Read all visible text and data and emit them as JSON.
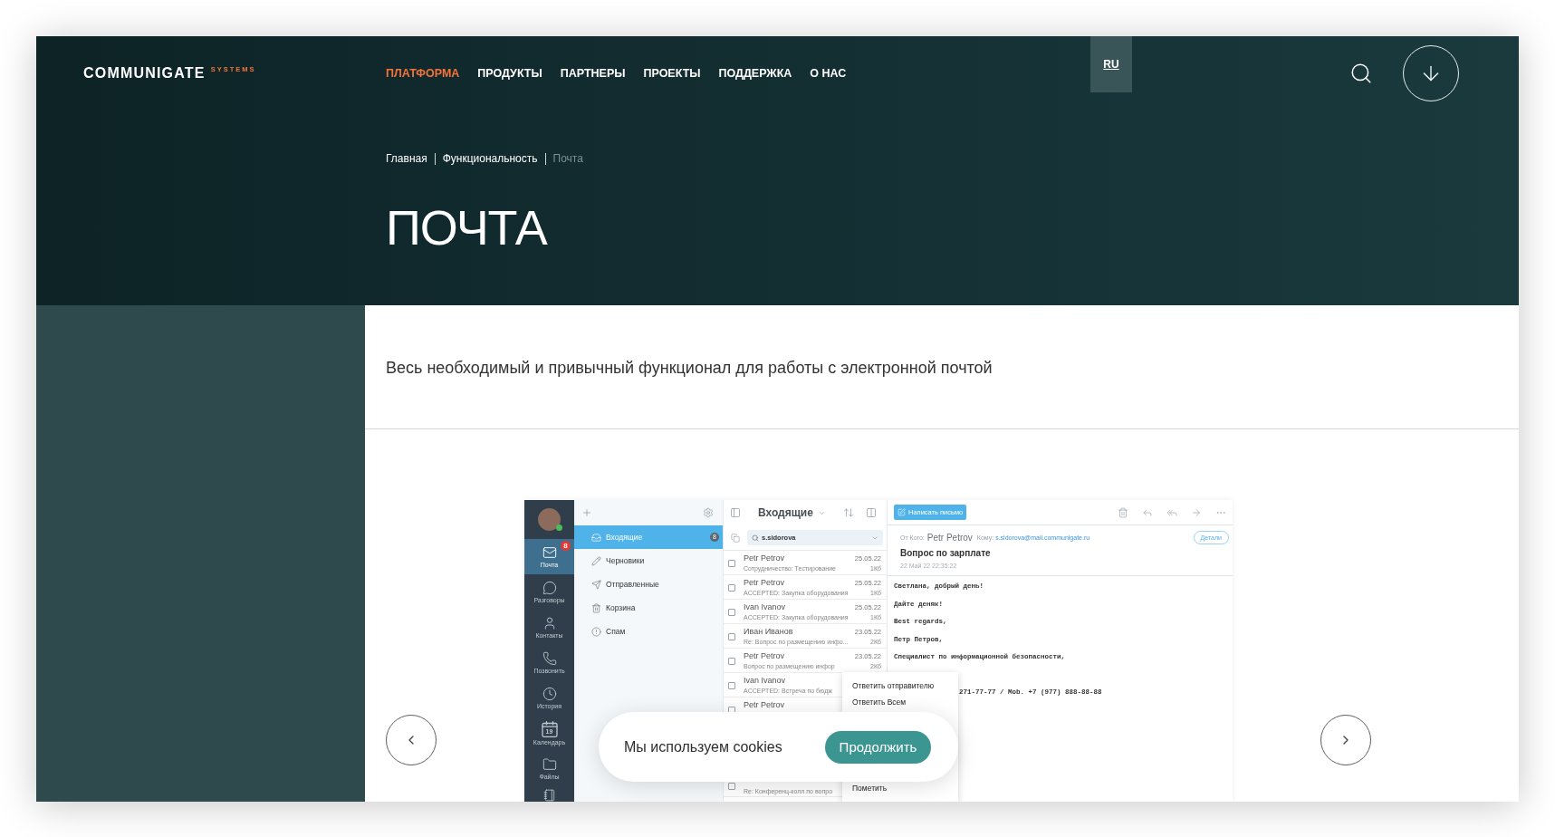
{
  "header": {
    "logo": {
      "wordmark": "COMMUNIGATE",
      "tagline": "SYSTEMS"
    },
    "nav": [
      {
        "label": "ПЛАТФОРМА",
        "selected": true
      },
      {
        "label": "ПРОДУКТЫ",
        "selected": false
      },
      {
        "label": "ПАРТНЕРЫ",
        "selected": false
      },
      {
        "label": "ПРОЕКТЫ",
        "selected": false
      },
      {
        "label": "ПОДДЕРЖКА",
        "selected": false
      },
      {
        "label": "О НАС",
        "selected": false
      }
    ],
    "language": {
      "label": "RU",
      "selected": true
    }
  },
  "breadcrumbs": [
    {
      "label": "Главная",
      "current": false
    },
    {
      "label": "Функциональность",
      "current": false
    },
    {
      "label": "Почта",
      "current": true
    }
  ],
  "title": "ПОЧТА",
  "description": "Весь необходимый и привычный функционал для работы с электронной почтой",
  "mail_app": {
    "user": {
      "online": true
    },
    "sidebar": [
      {
        "label": "Почта",
        "selected": true,
        "badge": "8"
      },
      {
        "label": "Разговоры",
        "selected": false
      },
      {
        "label": "Контакты",
        "selected": false
      },
      {
        "label": "Позвонить",
        "selected": false
      },
      {
        "label": "История",
        "selected": false
      },
      {
        "label": "Календарь",
        "selected": false,
        "icon_text": "19"
      },
      {
        "label": "Файлы",
        "selected": false
      }
    ],
    "folders": [
      {
        "label": "Входящие",
        "selected": true,
        "count": "8"
      },
      {
        "label": "Черновики",
        "selected": false
      },
      {
        "label": "Отправленные",
        "selected": false
      },
      {
        "label": "Корзина",
        "selected": false
      },
      {
        "label": "Спам",
        "selected": false
      }
    ],
    "list": {
      "title": "Входящие",
      "search": {
        "value": "s.sidorova"
      },
      "messages": [
        {
          "sender": "Petr Petrov",
          "date": "25.05.22",
          "subject": "Сотрудничество: Тестирование",
          "size": "1Кб",
          "checked": false
        },
        {
          "sender": "Petr Petrov",
          "date": "25.05.22",
          "subject": "ACCEPTED: Закупка оборудования",
          "size": "1Кб",
          "checked": false
        },
        {
          "sender": "Ivan Ivanov",
          "date": "25.05.22",
          "subject": "ACCEPTED: Закупка оборудования",
          "size": "1Кб",
          "checked": false
        },
        {
          "sender": "Иван Иванов",
          "date": "23.05.22",
          "subject": "Re: Вопрос по размещению инфо...",
          "size": "2Кб",
          "checked": false
        },
        {
          "sender": "Petr Petrov",
          "date": "23.05.22",
          "subject": "Вопрос по размещению инфор",
          "size": "2Кб",
          "checked": false
        },
        {
          "sender": "Ivan Ivanov",
          "subject": "ACCEPTED: Встреча по бюдж",
          "checked": false
        },
        {
          "sender": "Petr Petrov",
          "checked": false
        }
      ],
      "last_message": {
        "subject": "Re: Конференц-колл по вопро",
        "checked": false
      }
    },
    "reader": {
      "compose_button": "Написать письмо",
      "from_label": "От Кого:",
      "from": "Petr Petrov",
      "to_label": "Кому:",
      "to": "s.sidorova@mail.communigate.ru",
      "details_button": "Детали",
      "subject": "Вопрос по зарплате",
      "date": "22 Май 22 22:35:22",
      "body": [
        "Светлана, добрый день!",
        "Дайте деняк!",
        "Best regards,",
        "Петр Петров,",
        "Специалист по информационной безопасности,"
      ],
      "contact_line": "271-77-77 / Mob. +7 (977) 888-88-88"
    },
    "context_menu": {
      "top_items": [
        "Ответить отправителю",
        "Ответить Всем"
      ],
      "bottom_items": [
        "Пометить"
      ]
    }
  },
  "cookie_banner": {
    "text": "Мы используем cookies",
    "button": "Продолжить"
  }
}
